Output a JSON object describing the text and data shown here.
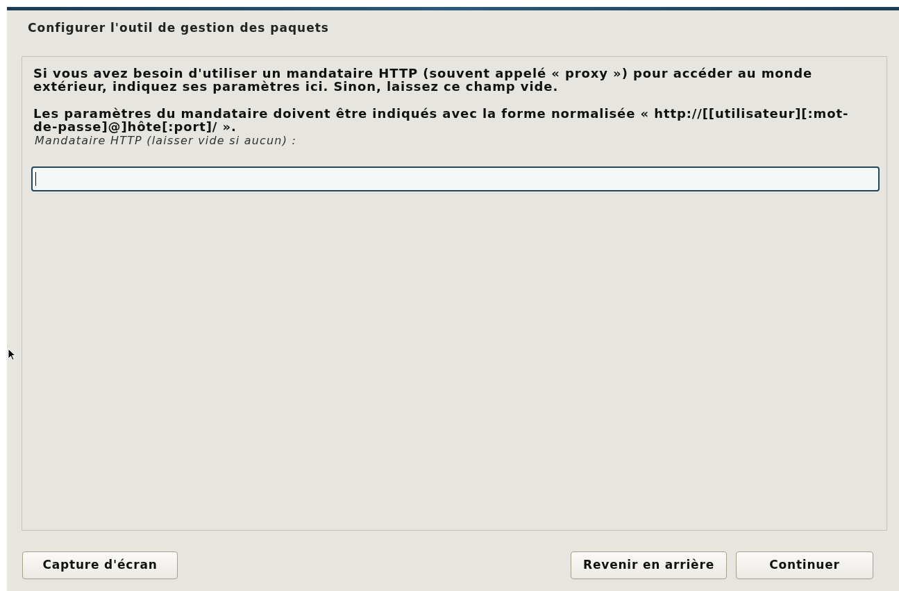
{
  "window": {
    "title": "Configurer l'outil de gestion des paquets"
  },
  "paragraphs": [
    "Si vous avez besoin d'utiliser un mandataire HTTP (souvent appelé « proxy ») pour accéder au monde extérieur, indiquez ses paramètres ici. Sinon, laissez ce champ vide.",
    "Les paramètres du mandataire doivent être indiqués avec la forme normalisée « http://[[utilisateur][:mot-de-passe]@]hôte[:port]/ »."
  ],
  "field": {
    "label": "Mandataire HTTP (laisser vide si aucun) :",
    "focused": true
  },
  "buttons_left": [
    "Capture d'écran"
  ],
  "buttons_right": [
    "Revenir en arrière",
    "Continuer"
  ]
}
